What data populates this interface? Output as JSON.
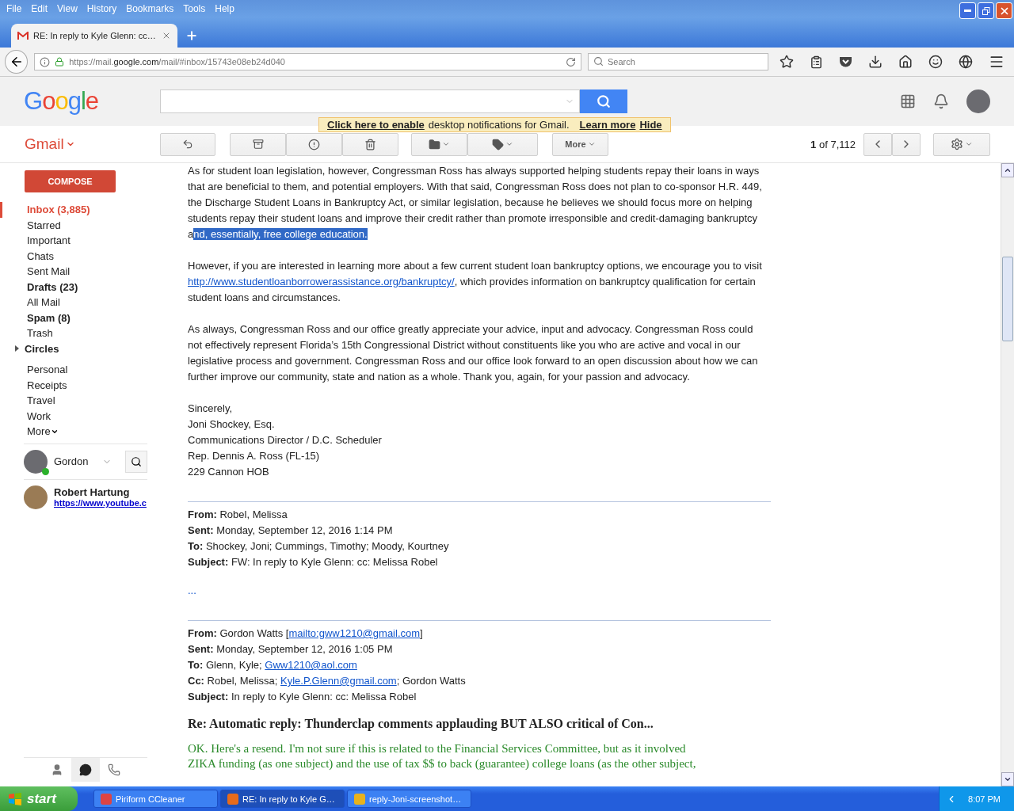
{
  "browser_menu": [
    "File",
    "Edit",
    "View",
    "History",
    "Bookmarks",
    "Tools",
    "Help"
  ],
  "tabs": [
    {
      "title": "RE: In reply to Kyle Glenn: cc…",
      "selected": true
    }
  ],
  "address": {
    "prefix": "https://mail.",
    "domain": "google.com",
    "rest": "/mail/#inbox/15743e08eb24d040"
  },
  "browser_search": {
    "placeholder": "Search"
  },
  "gmail": {
    "logo": "Google",
    "app": "Gmail",
    "more": "More",
    "counter_current": "1",
    "counter_total": "of 7,112"
  },
  "notification": {
    "link": "Click here to enable",
    "text": "desktop notifications for Gmail.",
    "learn": "Learn more",
    "hide": "Hide"
  },
  "compose": "COMPOSE",
  "folders": [
    {
      "label": "Inbox (3,885)",
      "selected": true,
      "unread": true,
      "kind": "folder"
    },
    {
      "label": "Starred",
      "selected": false,
      "unread": false,
      "kind": "folder"
    },
    {
      "label": "Important",
      "selected": false,
      "unread": false,
      "kind": "folder"
    },
    {
      "label": "Chats",
      "selected": false,
      "unread": false,
      "kind": "folder"
    },
    {
      "label": "Sent Mail",
      "selected": false,
      "unread": false,
      "kind": "folder"
    },
    {
      "label": "Drafts (23)",
      "selected": false,
      "unread": true,
      "kind": "folder"
    },
    {
      "label": "All Mail",
      "selected": false,
      "unread": false,
      "kind": "folder"
    },
    {
      "label": "Spam (8)",
      "selected": false,
      "unread": true,
      "kind": "folder"
    },
    {
      "label": "Trash",
      "selected": false,
      "unread": false,
      "kind": "folder"
    },
    {
      "label": "Circles",
      "selected": false,
      "unread": true,
      "kind": "group",
      "expanded": false
    }
  ],
  "labels": [
    {
      "label": "Personal",
      "selected": false
    },
    {
      "label": "Receipts",
      "selected": false
    },
    {
      "label": "Travel",
      "selected": false
    },
    {
      "label": "Work",
      "selected": false
    }
  ],
  "labels_more": "More",
  "chat": {
    "me": "Gordon",
    "online": true,
    "contacts": [
      {
        "name": "Robert Hartung",
        "link": "https://www.youtube.c"
      }
    ]
  },
  "chat_tabs": [
    {
      "kind": "people",
      "selected": false
    },
    {
      "kind": "hangouts",
      "selected": true
    },
    {
      "kind": "phone",
      "selected": false
    }
  ],
  "paragraphs": [
    [
      {
        "kind": "text",
        "text": "As for student loan legislation, however, Congressman Ross has always supported helping students repay their loans in ways that are beneficial to them, and potential employers. With that said, Congressman Ross does not plan to co-sponsor H.R. 449, the Discharge Student Loans in Bankruptcy Act, or similar legislation, because he believes we should focus more on helping students repay their student loans and improve their credit rather than promote irresponsible and credit-damaging bankruptcy a"
      },
      {
        "kind": "selection",
        "text": "nd, essentially, free college education. "
      }
    ],
    [
      {
        "kind": "text",
        "text": "However, if you are interested in learning more about a few current student loan bankruptcy options, we encourage you to visit "
      },
      {
        "kind": "link",
        "text": "http://www.studentloanborrowerassistance.org/bankruptcy/"
      },
      {
        "kind": "text",
        "text": ", which provides information on bankruptcy qualification for certain student loans and circumstances."
      }
    ],
    [
      {
        "kind": "text",
        "text": "As always, Congressman Ross and our office greatly appreciate your advice, input and advocacy. Congressman Ross could not effectively represent Florida’s 15th Congressional District without constituents like you who are active and vocal in our legislative process and government. Congressman Ross and our office look forward to an open discussion about how we can further improve our community, state and nation as a whole. Thank you, again, for your passion and advocacy."
      }
    ]
  ],
  "signature": [
    "Sincerely,",
    "Joni Shockey, Esq.",
    "Communications Director / D.C. Scheduler",
    "Rep. Dennis A. Ross (FL-15)",
    "229 Cannon HOB"
  ],
  "quotes": [
    {
      "fields": [
        {
          "label": "From:",
          "parts": [
            {
              "kind": "text",
              "text": "Robel, Melissa"
            }
          ]
        },
        {
          "label": "Sent:",
          "parts": [
            {
              "kind": "text",
              "text": "Monday, September 12, 2016 1:14 PM"
            }
          ]
        },
        {
          "label": "To:",
          "parts": [
            {
              "kind": "text",
              "text": "Shockey, Joni; Cummings, Timothy; Moody, Kourtney"
            }
          ]
        },
        {
          "label": "Subject:",
          "parts": [
            {
              "kind": "text",
              "text": "FW: In reply to Kyle Glenn: cc: Melissa Robel"
            }
          ]
        }
      ],
      "trimmed": "..."
    },
    {
      "fields": [
        {
          "label": "From:",
          "parts": [
            {
              "kind": "text",
              "text": "Gordon Watts ["
            },
            {
              "kind": "link",
              "text": "mailto:gww1210@gmail.com"
            },
            {
              "kind": "text",
              "text": "]"
            }
          ]
        },
        {
          "label": "Sent:",
          "parts": [
            {
              "kind": "text",
              "text": "Monday, September 12, 2016 1:05 PM"
            }
          ]
        },
        {
          "label": "To:",
          "parts": [
            {
              "kind": "text",
              "text": "Glenn, Kyle; "
            },
            {
              "kind": "link",
              "text": "Gww1210@aol.com"
            }
          ]
        },
        {
          "label": "Cc:",
          "parts": [
            {
              "kind": "text",
              "text": "Robel, Melissa; "
            },
            {
              "kind": "link",
              "text": "Kyle.P.Glenn@gmail.com"
            },
            {
              "kind": "text",
              "text": "; Gordon Watts"
            }
          ]
        },
        {
          "label": "Subject:",
          "parts": [
            {
              "kind": "text",
              "text": "In reply to Kyle Glenn: cc: Melissa Robel"
            }
          ]
        }
      ]
    }
  ],
  "forwarded_subject": "Re: Automatic reply: Thunderclap comments applauding BUT ALSO critical of Con...",
  "green_lines": [
    "OK. Here's a resend. I'm not sure if this is related to the Financial Services Committee, but as it involved",
    "ZIKA funding (as one subject) and the use of tax $$ to back (guarantee) college loans (as the other subject,"
  ],
  "taskbar": {
    "start": "start",
    "tasks": [
      {
        "label": "Piriform CCleaner",
        "selected": false,
        "kind": "cleaner"
      },
      {
        "label": "RE: In reply to Kyle G…",
        "selected": true,
        "kind": "browser"
      },
      {
        "label": "reply-Joni-screenshot…",
        "selected": false,
        "kind": "paint"
      }
    ],
    "clock": "8:07 PM"
  }
}
